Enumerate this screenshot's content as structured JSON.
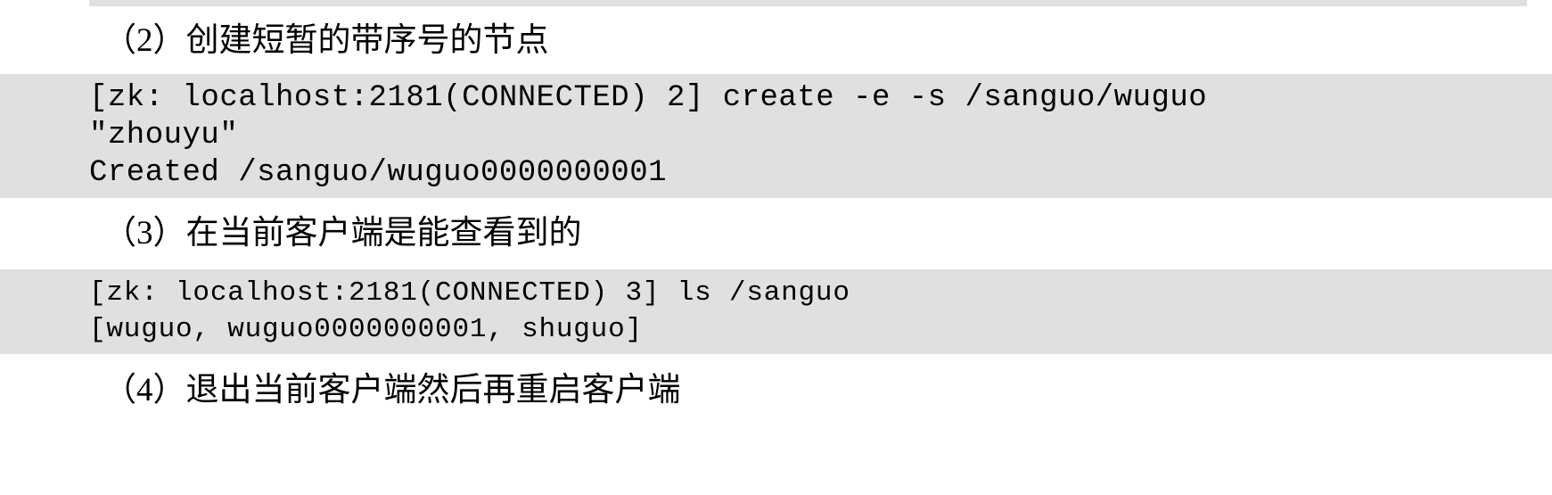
{
  "document": {
    "type": "zookeeper-cli-tutorial-excerpt",
    "background_color": "#ffffff",
    "code_block_color": "#e0e0e0",
    "text_color": "#000000"
  },
  "sections": [
    {
      "id": "section-2",
      "heading": "（2）创建短暂的带序号的节点",
      "code_lines": [
        "[zk: localhost:2181(CONNECTED) 2] create -e -s /sanguo/wuguo",
        "\"zhouyu\"",
        "Created /sanguo/wuguo0000000001"
      ]
    },
    {
      "id": "section-3",
      "heading": "（3）在当前客户端是能查看到的",
      "code_lines": [
        "[zk: localhost:2181(CONNECTED) 3] ls /sanguo",
        "[wuguo, wuguo0000000001, shuguo]"
      ]
    },
    {
      "id": "section-4",
      "heading": "（4）退出当前客户端然后再重启客户端",
      "code_lines": []
    }
  ]
}
